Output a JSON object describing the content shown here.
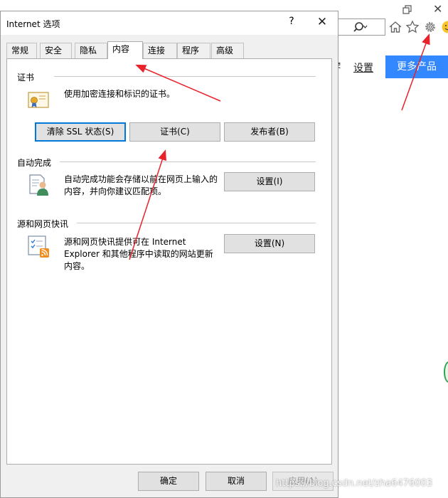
{
  "browser": {
    "settings_link": "设置",
    "more_products": "更多产品",
    "partial_text": "≷",
    "accent": "#3388ff",
    "icons": [
      "restore-icon",
      "close-icon",
      "search-icon",
      "home-icon",
      "favorites-star-icon",
      "tools-gear-icon",
      "smiley-feedback-icon"
    ]
  },
  "dialog": {
    "title": "Internet 选项",
    "help_glyph": "?",
    "close_glyph": "✕",
    "tabs": [
      {
        "label": "常规",
        "active": false
      },
      {
        "label": "安全",
        "active": false
      },
      {
        "label": "隐私",
        "active": false
      },
      {
        "label": "内容",
        "active": true
      },
      {
        "label": "连接",
        "active": false
      },
      {
        "label": "程序",
        "active": false
      },
      {
        "label": "高级",
        "active": false
      }
    ],
    "certificates": {
      "label": "证书",
      "description": "使用加密连接和标识的证书。",
      "clear_ssl": "清除 SSL 状态(S)",
      "certificates_btn": "证书(C)",
      "publishers_btn": "发布者(B)"
    },
    "autocomplete": {
      "label": "自动完成",
      "description_line1": "自动完成功能会存储以前在网页上输入的",
      "description_line2": "内容，并向你建议匹配项。",
      "settings_btn": "设置(I)"
    },
    "feeds": {
      "label": "源和网页快讯",
      "description_line1": "源和网页快讯提供可在 Internet",
      "description_line2": "Explorer 和其他程序中读取的网站更新",
      "description_line3": "内容。",
      "settings_btn": "设置(N)"
    },
    "footer": {
      "ok": "确定",
      "cancel": "取消",
      "apply": "应用(A)"
    }
  },
  "watermark": "https://blog.csdn.net/zha6476003",
  "annotation_color": "#e8212a"
}
